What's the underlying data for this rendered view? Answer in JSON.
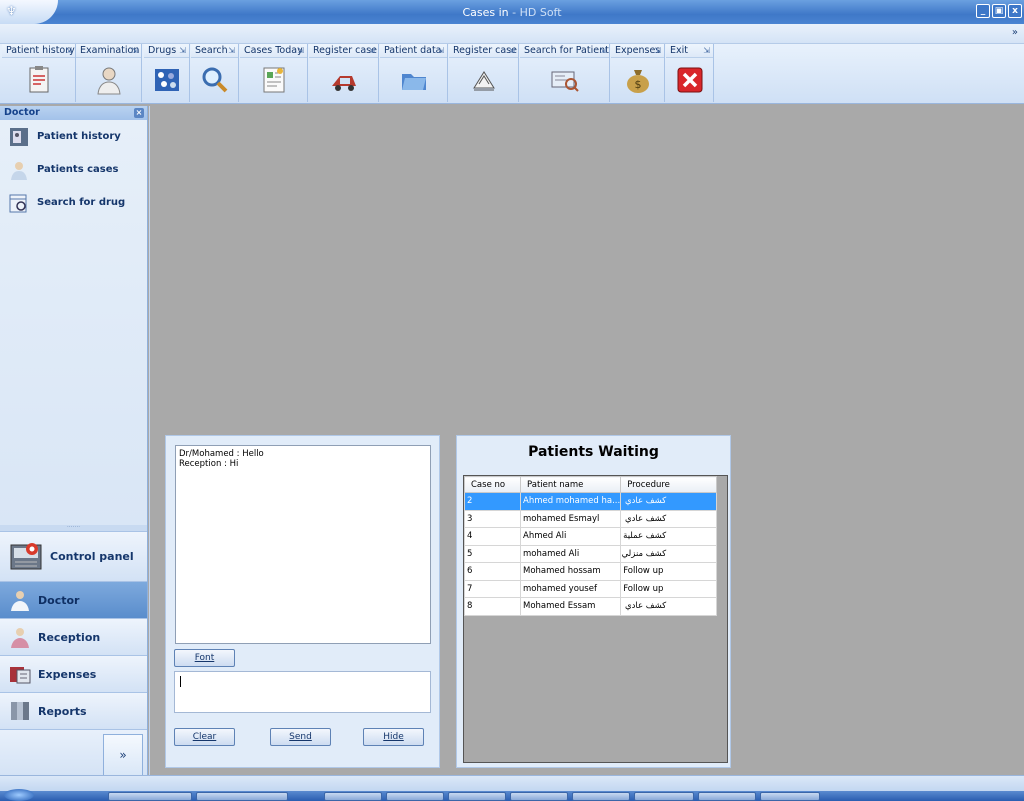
{
  "window": {
    "title": "Cases in",
    "subtitle": " - HD Soft",
    "controls": [
      "_",
      "▣",
      "x"
    ]
  },
  "ribbon": {
    "collapse_glyph": "»",
    "launcher_glyph": "⇲",
    "tools": [
      {
        "label": "Patient history",
        "icon": "clipboard-icon"
      },
      {
        "label": "Examination",
        "icon": "doctor-icon"
      },
      {
        "label": "Drugs",
        "icon": "pills-icon"
      },
      {
        "label": "Search",
        "icon": "magnifier-icon"
      },
      {
        "label": "Cases Today",
        "icon": "document-icon"
      },
      {
        "label": "Register case",
        "icon": "ambulance-icon"
      },
      {
        "label": "Patient  data",
        "icon": "folder-icon"
      },
      {
        "label": "Register case",
        "icon": "register-icon"
      },
      {
        "label": "Search for  Patient",
        "icon": "card-search-icon"
      },
      {
        "label": "Expenses",
        "icon": "money-bag-icon"
      },
      {
        "label": "Exit",
        "icon": "exit-icon"
      }
    ]
  },
  "nav": {
    "section_title": "Doctor",
    "items": [
      {
        "label": "Patient history",
        "icon": "phone-card-icon"
      },
      {
        "label": "Patients cases",
        "icon": "patient-icon"
      },
      {
        "label": "Search for drug",
        "icon": "calendar-search-icon"
      }
    ],
    "buttons": [
      {
        "label": "Control panel",
        "icon": "control-panel-icon"
      },
      {
        "label": "Doctor",
        "icon": "doctor-icon"
      },
      {
        "label": "Reception",
        "icon": "receptionist-icon"
      },
      {
        "label": "Expenses",
        "icon": "expenses-icon"
      },
      {
        "label": "Reports",
        "icon": "reports-icon"
      }
    ],
    "more_glyph": "»"
  },
  "chat": {
    "messages": [
      "Dr/Mohamed : Hello",
      "Reception : Hi"
    ],
    "input_value": "",
    "font_button": "Font",
    "clear_button": "Clear",
    "send_button": "Send",
    "hide_button": "Hide"
  },
  "waiting": {
    "title": "Patients Waiting",
    "columns": [
      "Case no",
      "Patient name",
      "Procedure"
    ],
    "rows": [
      {
        "case": "2",
        "name": "Ahmed mohamed ha...",
        "procedure": "كشف عادي"
      },
      {
        "case": "3",
        "name": "mohamed Esmayl",
        "procedure": "كشف عادي"
      },
      {
        "case": "4",
        "name": "Ahmed Ali",
        "procedure": "كشف عملية"
      },
      {
        "case": "5",
        "name": "mohamed Ali",
        "procedure": "كشف منزلي"
      },
      {
        "case": "6",
        "name": "Mohamed hossam",
        "procedure": "Follow up"
      },
      {
        "case": "7",
        "name": "mohamed yousef",
        "procedure": "Follow up"
      },
      {
        "case": "8",
        "name": "Mohamed Essam",
        "procedure": "كشف عادي"
      }
    ]
  },
  "colors": {
    "accent": "#3f78c8",
    "selection": "#3399ff",
    "exit_red": "#d9262a"
  }
}
